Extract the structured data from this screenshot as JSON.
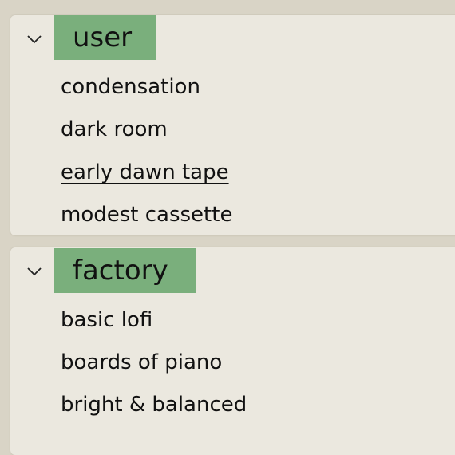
{
  "groups": [
    {
      "title": "user",
      "presets": [
        "condensation",
        "dark room",
        "early dawn tape",
        "modest cassette"
      ],
      "selected": "early dawn tape"
    },
    {
      "title": "factory",
      "presets": [
        "basic lofi",
        "boards of piano",
        "bright & balanced"
      ]
    }
  ],
  "icons": {
    "collapse": "chevron-down-icon"
  },
  "colors": {
    "background": "#d9d4c6",
    "panel": "#ebe8df",
    "group_header": "#7aaf7c",
    "text": "#111111"
  }
}
